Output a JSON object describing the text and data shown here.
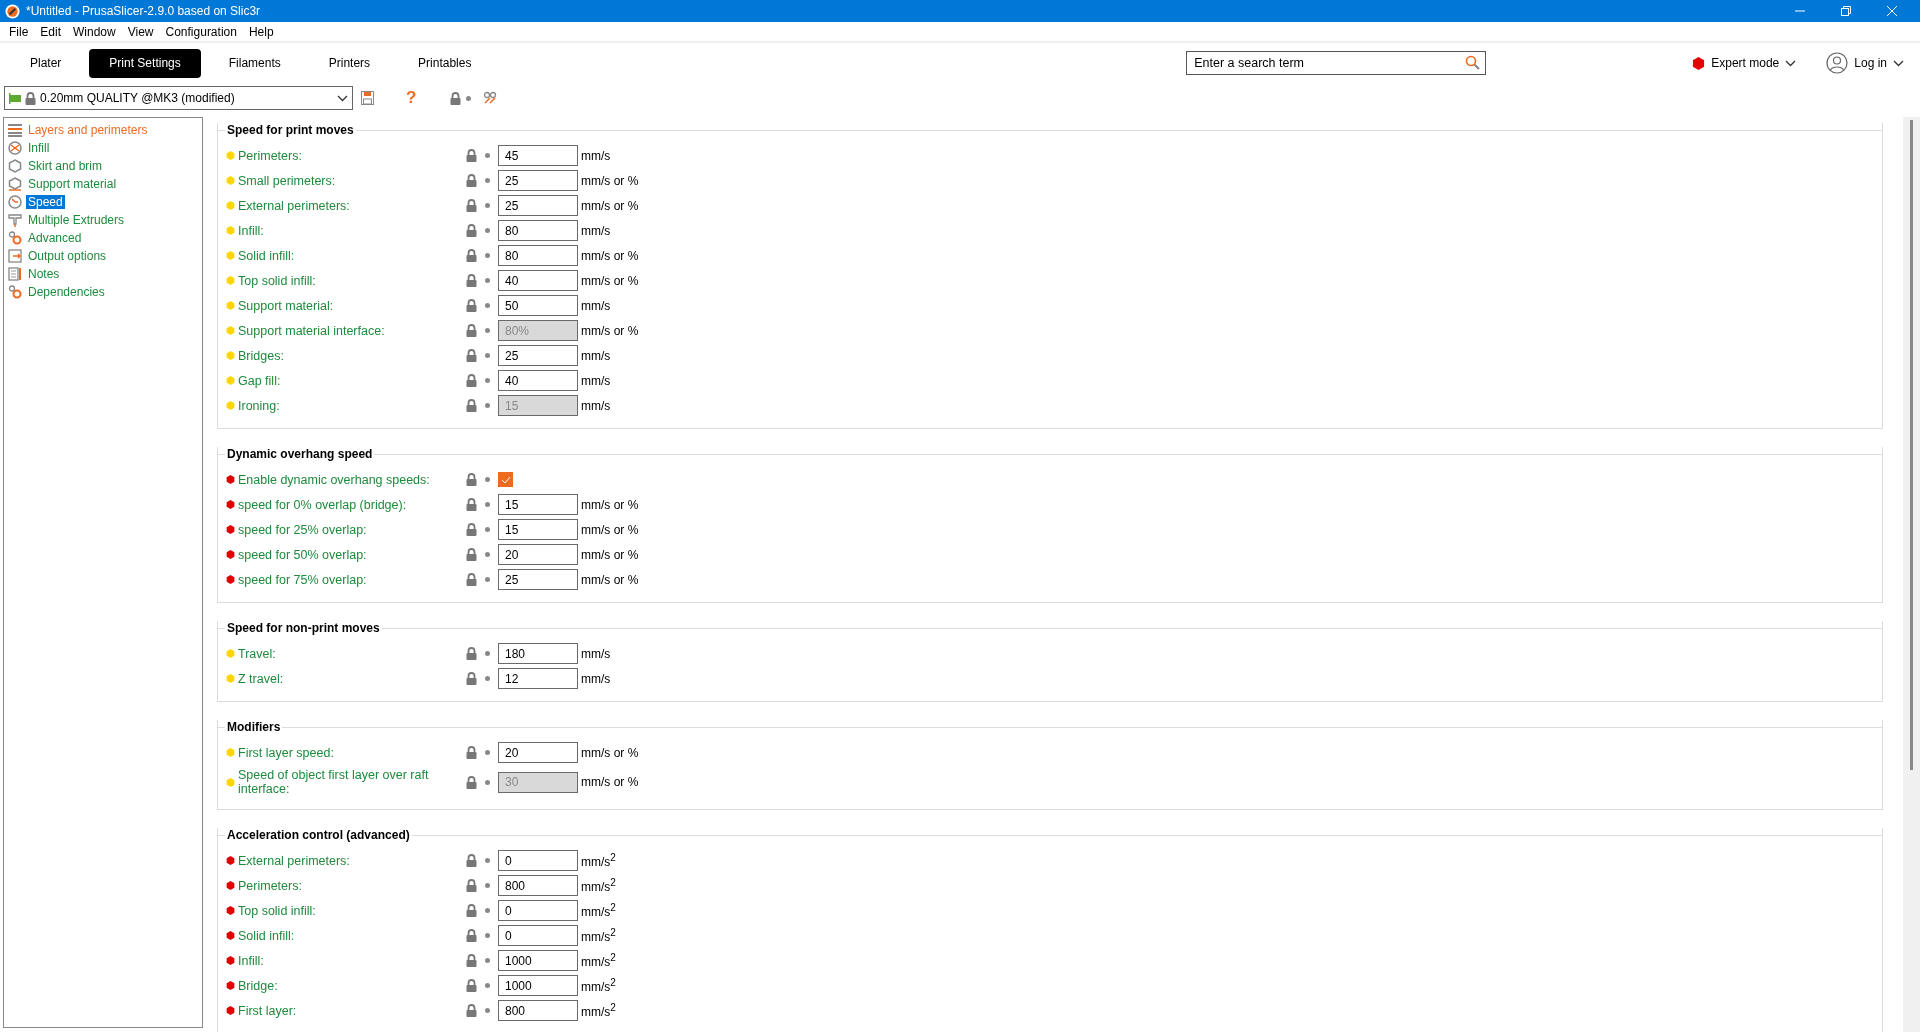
{
  "window": {
    "title": "*Untitled - PrusaSlicer-2.9.0 based on Slic3r"
  },
  "menu": [
    "File",
    "Edit",
    "Window",
    "View",
    "Configuration",
    "Help"
  ],
  "tabs": [
    {
      "label": "Plater",
      "selected": false
    },
    {
      "label": "Print Settings",
      "selected": true
    },
    {
      "label": "Filaments",
      "selected": false
    },
    {
      "label": "Printers",
      "selected": false
    },
    {
      "label": "Printables",
      "selected": false
    }
  ],
  "search": {
    "placeholder": "Enter a search term"
  },
  "mode": {
    "label": "Expert mode",
    "color": "#e30000"
  },
  "login": {
    "label": "Log in"
  },
  "preset": {
    "value": "0.20mm QUALITY @MK3 (modified)"
  },
  "toolbar": [
    {
      "kind": "save"
    },
    {
      "kind": "help",
      "label": "?"
    },
    {
      "kind": "lock"
    },
    {
      "kind": "compare"
    }
  ],
  "sidebar": {
    "items": [
      {
        "label": "Layers and perimeters",
        "modified": true,
        "selected": false
      },
      {
        "label": "Infill",
        "modified": false,
        "selected": false
      },
      {
        "label": "Skirt and brim",
        "modified": false,
        "selected": false
      },
      {
        "label": "Support material",
        "modified": false,
        "selected": false
      },
      {
        "label": "Speed",
        "modified": false,
        "selected": true
      },
      {
        "label": "Multiple Extruders",
        "modified": false,
        "selected": false
      },
      {
        "label": "Advanced",
        "modified": false,
        "selected": false
      },
      {
        "label": "Output options",
        "modified": false,
        "selected": false
      },
      {
        "label": "Notes",
        "modified": false,
        "selected": false
      },
      {
        "label": "Dependencies",
        "modified": false,
        "selected": false
      }
    ]
  },
  "sections": [
    {
      "title": "Speed for print moves",
      "rows": [
        {
          "kind": "input",
          "label": "Perimeters:",
          "value": "45",
          "unit": "mm/s",
          "color": "#ffd700",
          "disabled": false
        },
        {
          "kind": "input",
          "label": "Small perimeters:",
          "value": "25",
          "unit": "mm/s or %",
          "color": "#ffd700",
          "disabled": false
        },
        {
          "kind": "input",
          "label": "External perimeters:",
          "value": "25",
          "unit": "mm/s or %",
          "color": "#ffd700",
          "disabled": false
        },
        {
          "kind": "input",
          "label": "Infill:",
          "value": "80",
          "unit": "mm/s",
          "color": "#ffd700",
          "disabled": false
        },
        {
          "kind": "input",
          "label": "Solid infill:",
          "value": "80",
          "unit": "mm/s or %",
          "color": "#ffd700",
          "disabled": false
        },
        {
          "kind": "input",
          "label": "Top solid infill:",
          "value": "40",
          "unit": "mm/s or %",
          "color": "#ffd700",
          "disabled": false
        },
        {
          "kind": "input",
          "label": "Support material:",
          "value": "50",
          "unit": "mm/s",
          "color": "#ffd700",
          "disabled": false
        },
        {
          "kind": "input",
          "label": "Support material interface:",
          "value": "80%",
          "unit": "mm/s or %",
          "color": "#ffd700",
          "disabled": true
        },
        {
          "kind": "input",
          "label": "Bridges:",
          "value": "25",
          "unit": "mm/s",
          "color": "#ffd700",
          "disabled": false
        },
        {
          "kind": "input",
          "label": "Gap fill:",
          "value": "40",
          "unit": "mm/s",
          "color": "#ffd700",
          "disabled": false
        },
        {
          "kind": "input",
          "label": "Ironing:",
          "value": "15",
          "unit": "mm/s",
          "color": "#ffd700",
          "disabled": true
        }
      ]
    },
    {
      "title": "Dynamic overhang speed",
      "rows": [
        {
          "kind": "checkbox",
          "label": "Enable dynamic overhang speeds:",
          "checked": true,
          "color": "#e30000"
        },
        {
          "kind": "input",
          "label": "speed for 0% overlap (bridge):",
          "value": "15",
          "unit": "mm/s or %",
          "color": "#e30000",
          "disabled": false
        },
        {
          "kind": "input",
          "label": "speed for 25% overlap:",
          "value": "15",
          "unit": "mm/s or %",
          "color": "#e30000",
          "disabled": false
        },
        {
          "kind": "input",
          "label": "speed for 50% overlap:",
          "value": "20",
          "unit": "mm/s or %",
          "color": "#e30000",
          "disabled": false
        },
        {
          "kind": "input",
          "label": "speed for 75% overlap:",
          "value": "25",
          "unit": "mm/s or %",
          "color": "#e30000",
          "disabled": false
        }
      ]
    },
    {
      "title": "Speed for non-print moves",
      "rows": [
        {
          "kind": "input",
          "label": "Travel:",
          "value": "180",
          "unit": "mm/s",
          "color": "#ffd700",
          "disabled": false
        },
        {
          "kind": "input",
          "label": "Z travel:",
          "value": "12",
          "unit": "mm/s",
          "color": "#ffd700",
          "disabled": false
        }
      ]
    },
    {
      "title": "Modifiers",
      "rows": [
        {
          "kind": "input",
          "label": "First layer speed:",
          "value": "20",
          "unit": "mm/s or %",
          "color": "#ffd700",
          "disabled": false
        },
        {
          "kind": "input",
          "label": "Speed of object first layer over raft interface:",
          "value": "30",
          "unit": "mm/s or %",
          "color": "#ffd700",
          "disabled": true
        }
      ]
    },
    {
      "title": "Acceleration control (advanced)",
      "rows": [
        {
          "kind": "input",
          "label": "External perimeters:",
          "value": "0",
          "unit": "mm/s$^{2}$",
          "color": "#e30000",
          "disabled": false
        },
        {
          "kind": "input",
          "label": "Perimeters:",
          "value": "800",
          "unit": "mm/s$^{2}$",
          "color": "#e30000",
          "disabled": false
        },
        {
          "kind": "input",
          "label": "Top solid infill:",
          "value": "0",
          "unit": "mm/s$^{2}$",
          "color": "#e30000",
          "disabled": false
        },
        {
          "kind": "input",
          "label": "Solid infill:",
          "value": "0",
          "unit": "mm/s$^{2}$",
          "color": "#e30000",
          "disabled": false
        },
        {
          "kind": "input",
          "label": "Infill:",
          "value": "1000",
          "unit": "mm/s$^{2}$",
          "color": "#e30000",
          "disabled": false
        },
        {
          "kind": "input",
          "label": "Bridge:",
          "value": "1000",
          "unit": "mm/s$^{2}$",
          "color": "#e30000",
          "disabled": false
        },
        {
          "kind": "input",
          "label": "First layer:",
          "value": "800",
          "unit": "mm/s$^{2}$",
          "color": "#e30000",
          "disabled": false
        }
      ]
    }
  ]
}
